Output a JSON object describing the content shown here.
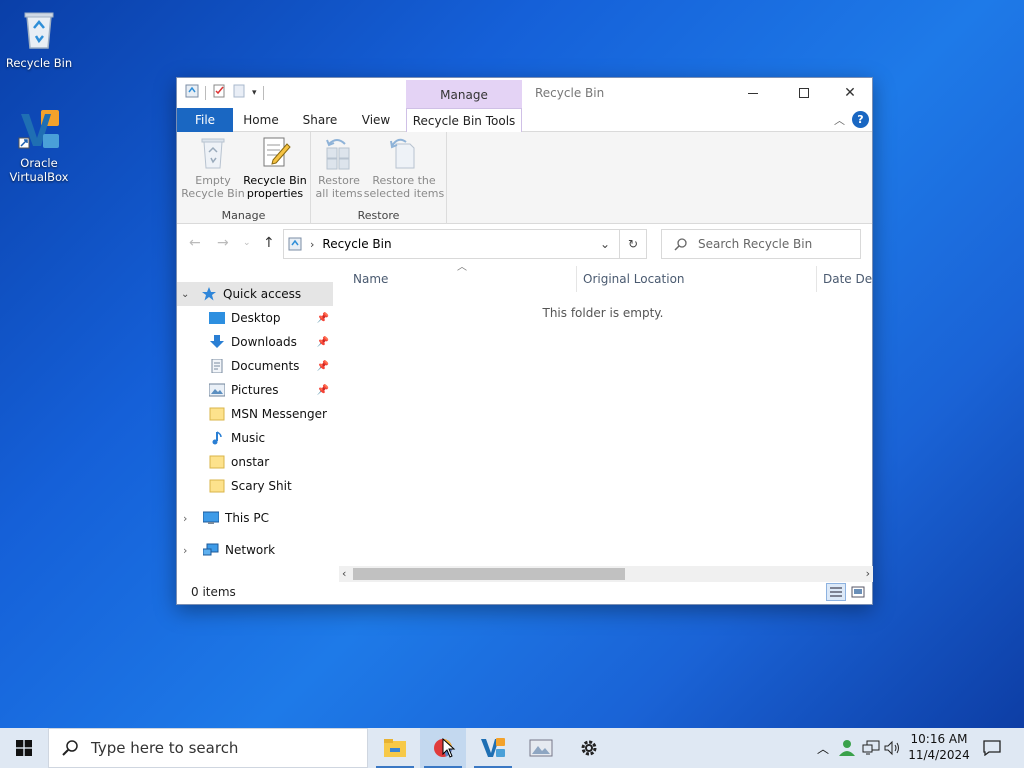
{
  "desktop": {
    "icons": [
      {
        "label": "Recycle Bin"
      },
      {
        "label": "Oracle VirtualBox"
      }
    ]
  },
  "window": {
    "title": "Recycle Bin",
    "manage_tab": "Manage",
    "tabs": {
      "file": "File",
      "home": "Home",
      "share": "Share",
      "view": "View",
      "recycle_bin_tools": "Recycle Bin Tools"
    },
    "ribbon": {
      "manage_group": {
        "label": "Manage",
        "empty_line1": "Empty",
        "empty_line2": "Recycle Bin",
        "props_line1": "Recycle Bin",
        "props_line2": "properties"
      },
      "restore_group": {
        "label": "Restore",
        "restore_all_line1": "Restore",
        "restore_all_line2": "all items",
        "restore_sel_line1": "Restore the",
        "restore_sel_line2": "selected items"
      }
    },
    "address": {
      "path": "Recycle Bin",
      "search_placeholder": "Search Recycle Bin"
    },
    "nav": {
      "quick_access": "Quick access",
      "items": [
        {
          "label": "Desktop",
          "pinned": true
        },
        {
          "label": "Downloads",
          "pinned": true
        },
        {
          "label": "Documents",
          "pinned": true
        },
        {
          "label": "Pictures",
          "pinned": true
        },
        {
          "label": "MSN Messenger",
          "pinned": false
        },
        {
          "label": "Music",
          "pinned": false
        },
        {
          "label": "onstar",
          "pinned": false
        },
        {
          "label": "Scary Shit",
          "pinned": false
        }
      ],
      "this_pc": "This PC",
      "network": "Network"
    },
    "columns": {
      "name": "Name",
      "original_location": "Original Location",
      "date_deleted": "Date Dele"
    },
    "empty_message": "This folder is empty.",
    "status": "0 items"
  },
  "taskbar": {
    "search_placeholder": "Type here to search",
    "clock_time": "10:16 AM",
    "clock_date": "11/4/2024"
  },
  "colors": {
    "accent": "#1a67c2",
    "manage_tab": "#e4d3f5",
    "taskbar": "#dfe8f3"
  }
}
